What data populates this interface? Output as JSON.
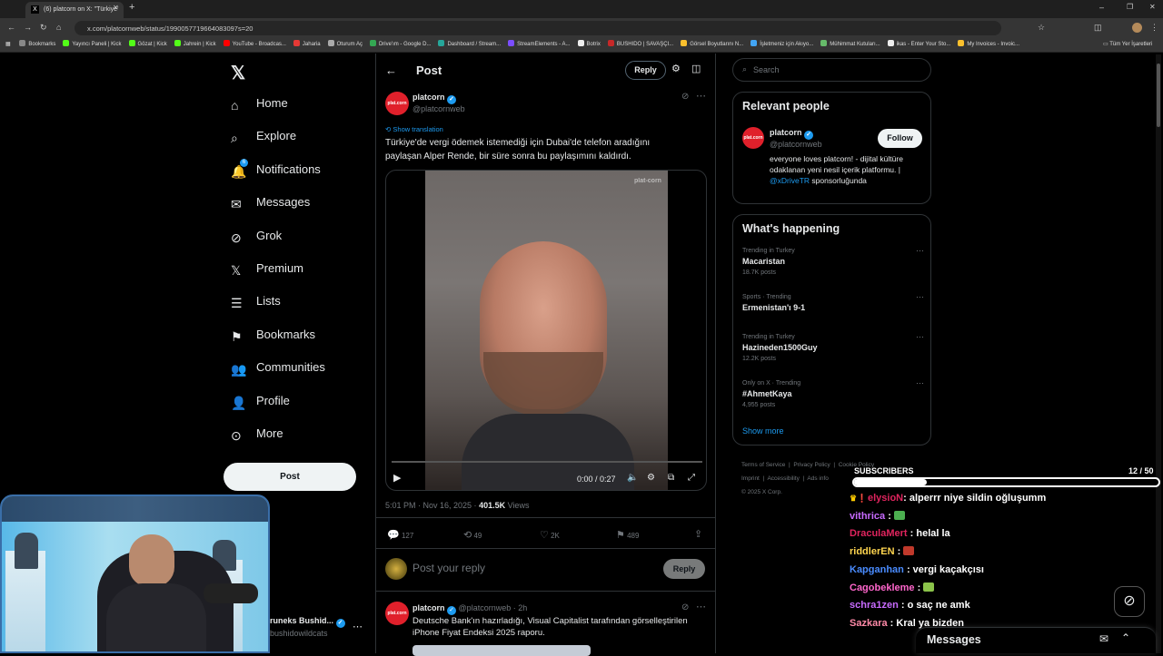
{
  "browser": {
    "tab_title": "(6) platcorn on X: \"Türkiye'",
    "url": "x.com/platcornweb/status/1990057719664083097s=20",
    "bookmarks": [
      {
        "label": "Bookmarks",
        "color": "#888888"
      },
      {
        "label": "Yayıncı Paneli | Kick",
        "color": "#53fc18"
      },
      {
        "label": "Gözat | Kick",
        "color": "#53fc18"
      },
      {
        "label": "Jahrein | Kick",
        "color": "#53fc18"
      },
      {
        "label": "YouTube - Broadcas...",
        "color": "#ff0000"
      },
      {
        "label": "Jaharia",
        "color": "#e53935"
      },
      {
        "label": "Oturum Aç",
        "color": "#aaaaaa"
      },
      {
        "label": "Drive'ım - Google D...",
        "color": "#34a853"
      },
      {
        "label": "Dashboard / Stream...",
        "color": "#26a69a"
      },
      {
        "label": "StreamElements - A...",
        "color": "#7b4dff"
      },
      {
        "label": "Botrix",
        "color": "#eeeeee"
      },
      {
        "label": "BUSHIDO | SAVAŞÇI...",
        "color": "#c62828"
      },
      {
        "label": "Görsel Boyutlarını N...",
        "color": "#fbc02d"
      },
      {
        "label": "İşletmeniz için Akıyo...",
        "color": "#42a5f5"
      },
      {
        "label": "Mühimmat Kutuları...",
        "color": "#66bb6a"
      },
      {
        "label": "ikas - Enter Your Sto...",
        "color": "#eeeeee"
      },
      {
        "label": "My Invoices - Invoic...",
        "color": "#fbc02d"
      }
    ],
    "all_bookmarks": "Tüm Yer İşaretleri"
  },
  "nav": {
    "items": [
      {
        "label": "Home",
        "icon": "home-icon"
      },
      {
        "label": "Explore",
        "icon": "search-icon"
      },
      {
        "label": "Notifications",
        "icon": "bell-icon",
        "badge": "6"
      },
      {
        "label": "Messages",
        "icon": "mail-icon"
      },
      {
        "label": "Grok",
        "icon": "grok-icon"
      },
      {
        "label": "Premium",
        "icon": "x-icon"
      },
      {
        "label": "Lists",
        "icon": "list-icon"
      },
      {
        "label": "Bookmarks",
        "icon": "bookmark-icon"
      },
      {
        "label": "Communities",
        "icon": "people-icon"
      },
      {
        "label": "Profile",
        "icon": "person-icon"
      },
      {
        "label": "More",
        "icon": "more-circle-icon"
      }
    ],
    "post_button": "Post",
    "account_name": "runeks Bushid...",
    "account_handle": "bushidowildcats"
  },
  "post": {
    "header_title": "Post",
    "reply_button": "Reply",
    "author_name": "platcorn",
    "author_handle": "@platcornweb",
    "show_translation": "Show translation",
    "text": "Türkiye'de vergi ödemek istemediği için Dubai'de telefon aradığını paylaşan Alper Rende, bir süre sonra bu paylaşımını kaldırdı.",
    "video_watermark": "plat-corn",
    "video_time": "0:00 / 0:27",
    "video_progress": 0.0,
    "timestamp": "5:01 PM · Nov 16, 2025 · ",
    "views_count": "401.5K",
    "views_label": " Views",
    "stats": {
      "replies": "127",
      "reposts": "49",
      "likes": "2K",
      "bookmarks": "489"
    },
    "reply_placeholder": "Post your reply",
    "reply_submit": "Reply",
    "next_author_name": "platcorn",
    "next_author_meta": "@platcornweb · 2h",
    "next_text": "Deutsche Bank'ın hazırladığı, Visual Capitalist tarafından görselleştirilen iPhone Fiyat Endeksi 2025 raporu."
  },
  "right": {
    "search_placeholder": "Search",
    "relevant_title": "Relevant people",
    "person_name": "platcorn",
    "person_handle": "@platcornweb",
    "follow": "Follow",
    "bio_text": "everyone loves platcorn! - dijital kültüre odaklanan yeni nesil içerik platformu. | ",
    "bio_link": "@xDriveTR",
    "bio_end": "sponsorluğunda",
    "happening_title": "What's happening",
    "trends": [
      {
        "context": "Trending in Turkey",
        "name": "Macaristan",
        "count": "18.7K posts"
      },
      {
        "context": "Sports · Trending",
        "name": "Ermenistan'ı 9-1",
        "count": ""
      },
      {
        "context": "Trending in Turkey",
        "name": "Hazineden1500Guy",
        "count": "12.2K posts"
      },
      {
        "context": "Only on X · Trending",
        "name": "#AhmetKaya",
        "count": "4,955 posts"
      }
    ],
    "show_more": "Show more",
    "footer": [
      "Terms of Service",
      "Privacy Policy",
      "Cookie Policy",
      "Imprint",
      "Accessibility",
      "Ads info"
    ],
    "copyright": "© 2025 X Corp.",
    "messages_label": "Messages"
  },
  "overlay": {
    "subscribers_label": "SUBSCRIBERS",
    "subscribers_count": "12 / 50",
    "subscribers_progress": 0.24,
    "chat": [
      {
        "user": "elysioN",
        "color": "#e0245e",
        "msg": ": alperrr niye sildin oğluşumm",
        "badge": true
      },
      {
        "user": "vithrica",
        "color": "#c86bff",
        "msg": " : ",
        "emote": "#4caf50"
      },
      {
        "user": "DraculaMert",
        "color": "#e0245e",
        "msg": " : helal la"
      },
      {
        "user": "riddlerEN",
        "color": "#ffd54f",
        "msg": " : ",
        "emote": "#c0392b"
      },
      {
        "user": "Kapganhan",
        "color": "#4a8cff",
        "msg": " : vergi kaçakçısı"
      },
      {
        "user": "Cagobekleme",
        "color": "#ff66cc",
        "msg": " : ",
        "emote": "#8bc34a"
      },
      {
        "user": "schra1zen",
        "color": "#c86bff",
        "msg": " : o saç ne amk"
      },
      {
        "user": "Sazkara",
        "color": "#ff8aa8",
        "msg": " : Kral ya bizden"
      }
    ]
  }
}
